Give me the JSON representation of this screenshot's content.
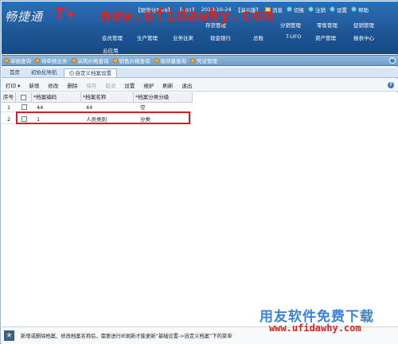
{
  "brand": {
    "logo_text": "畅捷通",
    "logo_mark": "T+"
  },
  "watermark": {
    "top": "new.ufidawhy.com",
    "bottom_cn": "用友软件免费下载",
    "bottom_url": "www.ufidawhy.com"
  },
  "info_bar": {
    "account_tag": "【销货分开09】",
    "company_tag": "【001】",
    "date": "2013-10-24",
    "mode_tag": "【演示版】",
    "message": "消息",
    "switch": "切换",
    "logout": "注销",
    "settings": "设置",
    "help": "帮助"
  },
  "menu_row1": [
    "存货管理",
    "分销管理",
    "零售管理",
    "促销管理"
  ],
  "menu_row2": [
    "会员管理",
    "生产管理",
    "业务往来",
    "现金银行",
    "总账",
    "T-UFO",
    "资产管理",
    "报表中心"
  ],
  "cloud_app": "云应用",
  "quick_toolbar": [
    "单据查询",
    "待审核业务",
    "采购价格查询",
    "销售价格查询",
    "现存量查询",
    "凭证管理"
  ],
  "tabs": [
    {
      "label": "首页",
      "active": false
    },
    {
      "label": "初始化导航",
      "active": false
    },
    {
      "label": "自定义档案设置",
      "active": true
    }
  ],
  "toolbar": {
    "print": "打印",
    "new": "新增",
    "edit": "修改",
    "delete": "删除",
    "save": "保存",
    "cancel": "取消",
    "setup": "设置",
    "maintain": "维护",
    "refresh": "刷新",
    "exit": "退出"
  },
  "grid": {
    "columns": [
      "序号",
      "*档案编码",
      "*档案名称",
      "*档案分类分级"
    ],
    "rows": [
      {
        "no": "1",
        "code": "44",
        "name": "44",
        "class": "空"
      },
      {
        "no": "2",
        "code": "1",
        "name": "人员类别",
        "class": "分类"
      }
    ]
  },
  "status_text": "新增或删除档案、修改档案名称后，需要进行IE刷新才能更新“基础设置->自定义档案”下的菜单",
  "colors": {
    "header_blue": "#1d5594",
    "highlight_red": "#d51f26",
    "required_red": "#d63a2c"
  }
}
